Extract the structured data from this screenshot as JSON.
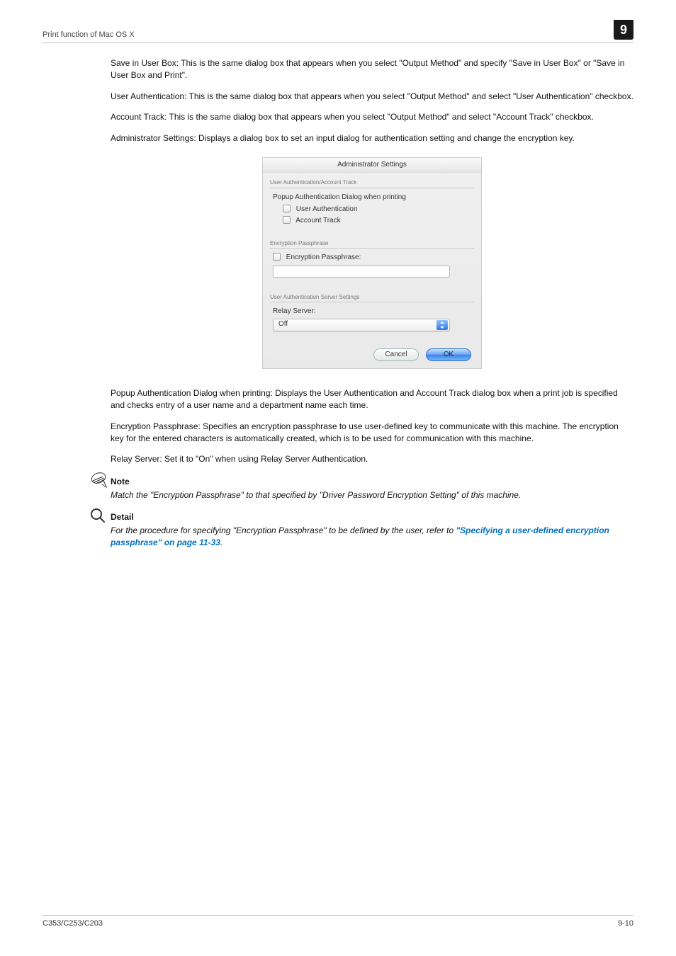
{
  "header": {
    "section_title": "Print function of Mac OS X",
    "badge": "9"
  },
  "body": {
    "p1": "Save in User Box: This is the same dialog box that appears when you select \"Output Method\" and specify \"Save in User Box\" or \"Save in User Box and Print\".",
    "p2": "User Authentication: This is the same dialog box that appears when you select \"Output Method\" and select \"User Authentication\" checkbox.",
    "p3": "Account Track: This is the same dialog box that appears when you select \"Output Method\" and select \"Account Track\" checkbox.",
    "p4": "Administrator Settings: Displays a dialog box to set an input dialog for authentication setting and change the encryption key.",
    "p5": "Popup Authentication Dialog when printing: Displays the User Authentication and Account Track dialog box when a print job is specified and checks entry of a user name and a department name each time.",
    "p6": "Encryption Passphrase: Specifies an encryption passphrase to use user-defined key to communicate with this machine. The encryption key for the entered characters is automatically created, which is to be used for communication with this machine.",
    "p7": "Relay Server: Set it to \"On\" when using Relay Server Authentication."
  },
  "dialog": {
    "title": "Administrator Settings",
    "sec1_title": "User Authentication/Account Track",
    "sec1_line1": "Popup Authentication Dialog when printing",
    "sec1_chk1": "User Authentication",
    "sec1_chk2": "Account Track",
    "sec2_title": "Encryption Passphrase",
    "sec2_chk": "Encryption Passphrase:",
    "sec3_title": "User Authentication Server Settings",
    "sec3_label": "Relay Server:",
    "sec3_select_value": "Off",
    "btn_cancel": "Cancel",
    "btn_ok": "OK"
  },
  "note": {
    "heading": "Note",
    "text": "Match the \"Encryption Passphrase\" to that specified by \"Driver Password Encryption Setting\" of this machine."
  },
  "detail": {
    "heading": "Detail",
    "text_prefix": "For the procedure for specifying \"Encryption Passphrase\" to be defined by the user, refer to ",
    "link": "\"Specifying a user-defined encryption passphrase\" on page 11-33",
    "text_suffix": "."
  },
  "footer": {
    "left": "C353/C253/C203",
    "right": "9-10"
  }
}
